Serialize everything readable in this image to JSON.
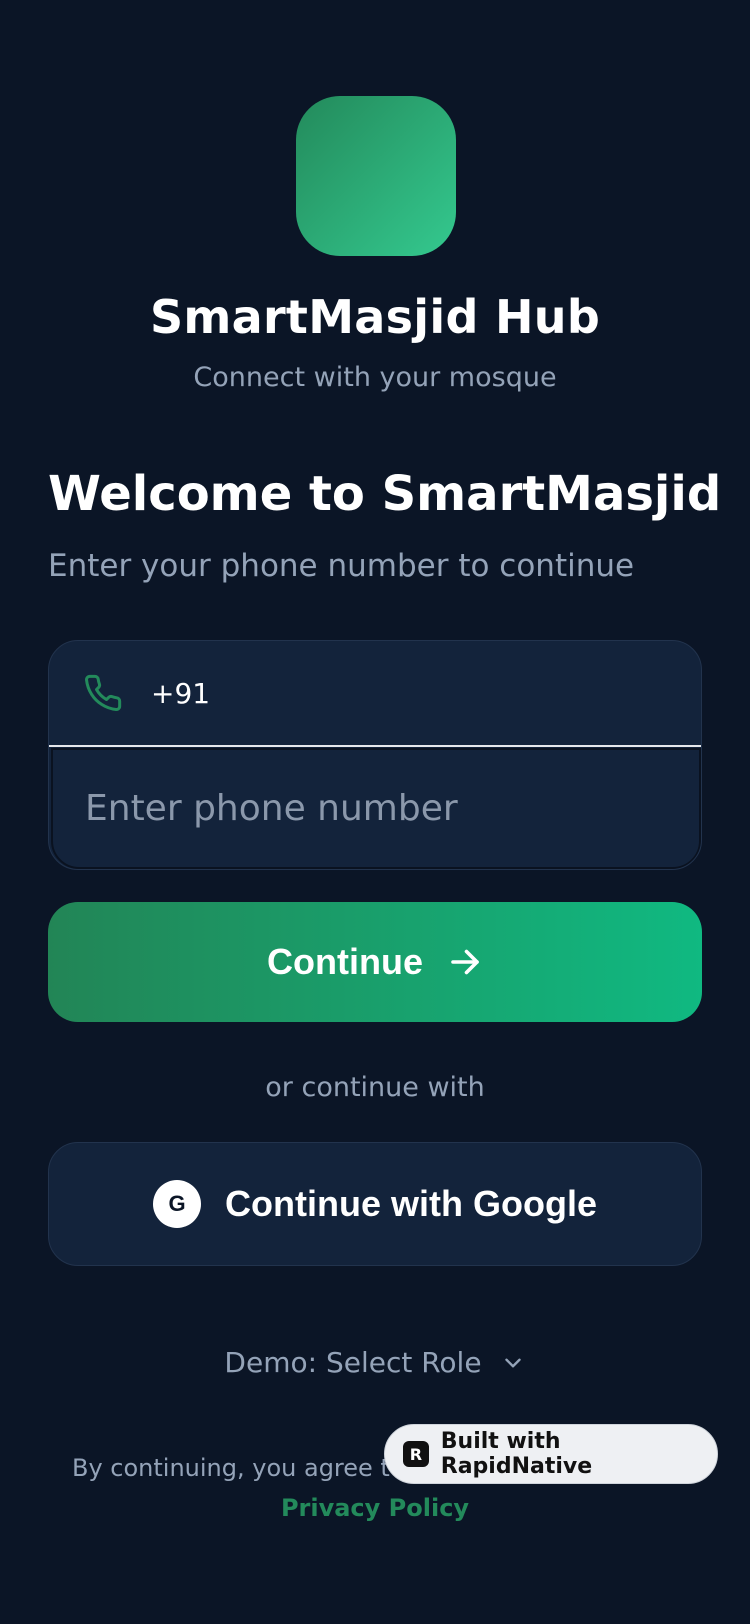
{
  "app": {
    "name": "SmartMasjid Hub",
    "tagline": "Connect with your mosque"
  },
  "welcome": {
    "title": "Welcome to SmartMasjid",
    "subtitle": "Enter your phone number to continue"
  },
  "phone": {
    "icon": "phone-icon",
    "country_code": "+91",
    "placeholder": "Enter phone number",
    "value": ""
  },
  "actions": {
    "continue_label": "Continue",
    "continue_icon": "arrow-right-icon",
    "or_text": "or continue with",
    "google_icon_letter": "G",
    "google_label": "Continue with Google"
  },
  "demo": {
    "label": "Demo: Select Role",
    "icon": "chevron-down-icon"
  },
  "footer": {
    "terms_text": "By continuing, you agree to o",
    "privacy_label": "Privacy Policy"
  },
  "badge": {
    "logo_letter": "R",
    "label": "Built with RapidNative"
  },
  "colors": {
    "background": "#0b1526",
    "card": "#13233b",
    "accent": "#238a5b",
    "accent_light": "#10b981",
    "muted_text": "#94a3b8"
  }
}
